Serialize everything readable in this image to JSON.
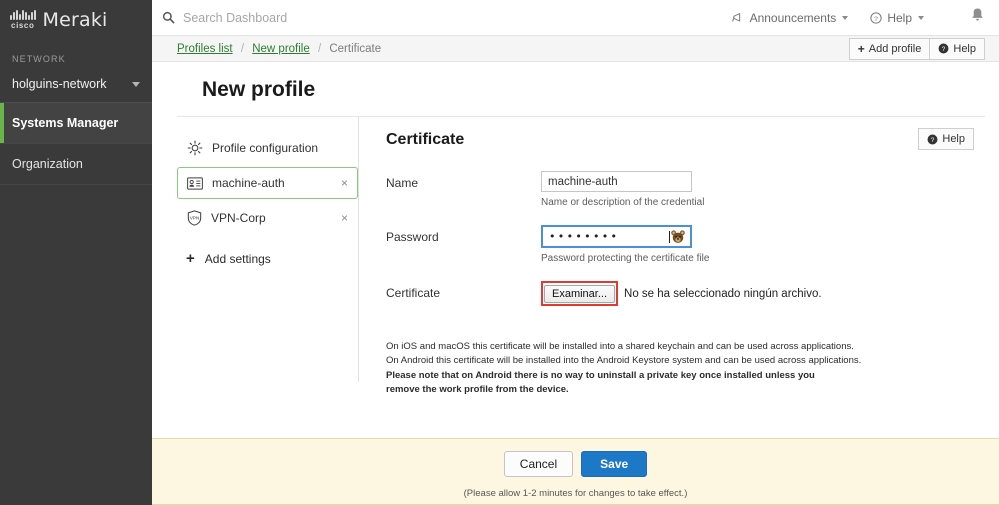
{
  "brand": {
    "cisco": "cisco",
    "name": "Meraki"
  },
  "sidebar": {
    "network_label": "NETWORK",
    "network_value": "holguins-network",
    "items": [
      {
        "label": "Systems Manager",
        "active": true
      },
      {
        "label": "Organization",
        "active": false
      }
    ]
  },
  "topbar": {
    "search_placeholder": "Search Dashboard",
    "search_value": "",
    "announcements": "Announcements",
    "help": "Help"
  },
  "breadcrumb": {
    "profiles_list": "Profiles list",
    "new_profile": "New profile",
    "current": "Certificate",
    "add_profile": "Add profile",
    "help": "Help"
  },
  "page": {
    "title": "New profile"
  },
  "settings_list": {
    "profile_configuration": "Profile configuration",
    "items": [
      {
        "label": "machine-auth",
        "icon": "id-card-icon",
        "selected": true,
        "close": "×"
      },
      {
        "label": "VPN-Corp",
        "icon": "vpn-shield-icon",
        "selected": false,
        "close": "×"
      }
    ],
    "add_settings": "Add settings",
    "add_icon": "+"
  },
  "form": {
    "heading": "Certificate",
    "help": "Help",
    "name": {
      "label": "Name",
      "value": "machine-auth",
      "placeholder": "",
      "hint": "Name or description of the credential"
    },
    "password": {
      "label": "Password",
      "value": "••••••••",
      "hint": "Password protecting the certificate file"
    },
    "certificate": {
      "label": "Certificate",
      "browse_button": "Examinar...",
      "no_file": "No se ha seleccionado ningún archivo."
    },
    "notes": [
      "On iOS and macOS this certificate will be installed into a shared keychain and can be used across applications.",
      "On Android this certificate will be installed into the Android Keystore system and can be used across applications.",
      "Please note that on Android there is no way to uninstall a private key once installed unless you remove the work profile from the device."
    ]
  },
  "footer": {
    "cancel": "Cancel",
    "save": "Save",
    "note": "(Please allow 1-2 minutes for changes to take effect.)"
  },
  "colors": {
    "sidebar_bg": "#3a3a3a",
    "accent_green": "#6ab547",
    "link_green": "#2f7d32",
    "save_blue": "#1e78c8",
    "footer_bg": "#fdf6e0",
    "highlight_red": "#e03a33",
    "focus_blue": "#4a90d9"
  }
}
